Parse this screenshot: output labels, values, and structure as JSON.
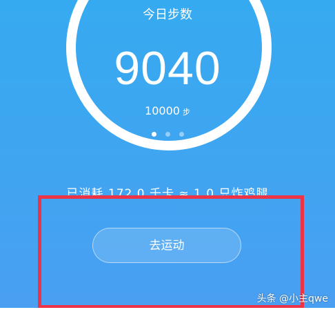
{
  "header": {
    "title": "今日步数"
  },
  "stats": {
    "steps": "9040",
    "goal_value": "10000",
    "goal_unit": "步",
    "summary": "已消耗 172.0 千卡 ≈ 1.0 只炸鸡腿"
  },
  "pager": {
    "count": 3,
    "active_index": 0
  },
  "actions": {
    "go_exercise_label": "去运动"
  },
  "watermark": {
    "text": "头条 @小主qwe"
  },
  "colors": {
    "background_top": "#36aaf0",
    "background_bottom": "#4a9ff2",
    "highlight_border": "#ec3446"
  }
}
